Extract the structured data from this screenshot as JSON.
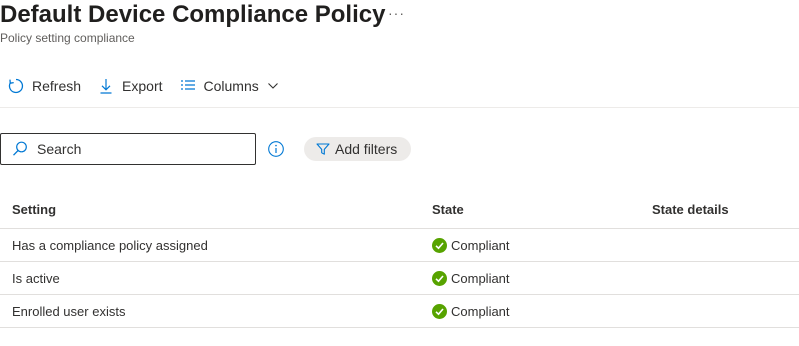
{
  "header": {
    "title": "Default Device Compliance Policy",
    "more_label": "···",
    "subtitle": "Policy setting compliance"
  },
  "toolbar": {
    "refresh_label": "Refresh",
    "refresh_icon": "refresh-icon",
    "export_label": "Export",
    "export_icon": "download-icon",
    "columns_label": "Columns",
    "columns_icon": "list-columns-icon"
  },
  "search": {
    "placeholder": "Search",
    "value": ""
  },
  "filters": {
    "add_filters_label": "Add filters",
    "icon": "filter-icon"
  },
  "table": {
    "columns": [
      "Setting",
      "State",
      "State details"
    ],
    "rows": [
      {
        "setting": "Has a compliance policy assigned",
        "state": "Compliant",
        "state_details": ""
      },
      {
        "setting": "Is active",
        "state": "Compliant",
        "state_details": ""
      },
      {
        "setting": "Enrolled user exists",
        "state": "Compliant",
        "state_details": ""
      }
    ]
  },
  "colors": {
    "accent": "#0078d4",
    "compliant_green": "#57a300",
    "text": "#323130",
    "border": "#e1dfdd",
    "pill_bg": "#edebe9"
  }
}
